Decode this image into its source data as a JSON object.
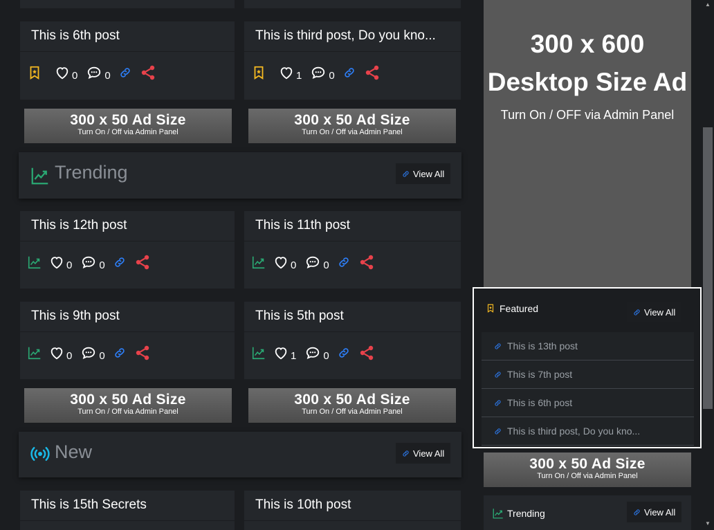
{
  "posts_row1": [
    {
      "title": "This is 6th post",
      "likes": "0",
      "comments": "0",
      "category_icon": "bookmark-star-icon"
    },
    {
      "title": "This is third post, Do you kno...",
      "likes": "1",
      "comments": "0",
      "category_icon": "bookmark-star-icon"
    }
  ],
  "ad_small": {
    "big": "300 x 50 Ad Size",
    "small": "Turn On / Off via Admin Panel"
  },
  "trending_section": {
    "title": "Trending",
    "view_all": "View All"
  },
  "trending_posts": [
    {
      "title": "This is 12th post",
      "likes": "0",
      "comments": "0"
    },
    {
      "title": "This is 11th post",
      "likes": "0",
      "comments": "0"
    },
    {
      "title": "This is 9th post",
      "likes": "0",
      "comments": "0"
    },
    {
      "title": "This is 5th post",
      "likes": "1",
      "comments": "0"
    }
  ],
  "new_section": {
    "title": "New",
    "view_all": "View All"
  },
  "new_posts": [
    {
      "title": "This is 15th Secrets"
    },
    {
      "title": "This is 10th post"
    }
  ],
  "big_ad": {
    "line1": "300 x 600",
    "line2": "Desktop Size Ad",
    "sub": "Turn On / OFF via Admin Panel"
  },
  "featured": {
    "title": "Featured",
    "view_all": "View All",
    "items": [
      "This is 13th post",
      "This is 7th post",
      "This is 6th post",
      "This is third post, Do you kno..."
    ]
  },
  "sidebar_trending": {
    "title": "Trending",
    "view_all": "View All"
  },
  "colors": {
    "accent_green": "#2aa873",
    "accent_blue": "#2d7ff9",
    "accent_red": "#e8424b",
    "bookmark_yellow": "#f5b921",
    "new_cyan": "#19b8e6"
  }
}
